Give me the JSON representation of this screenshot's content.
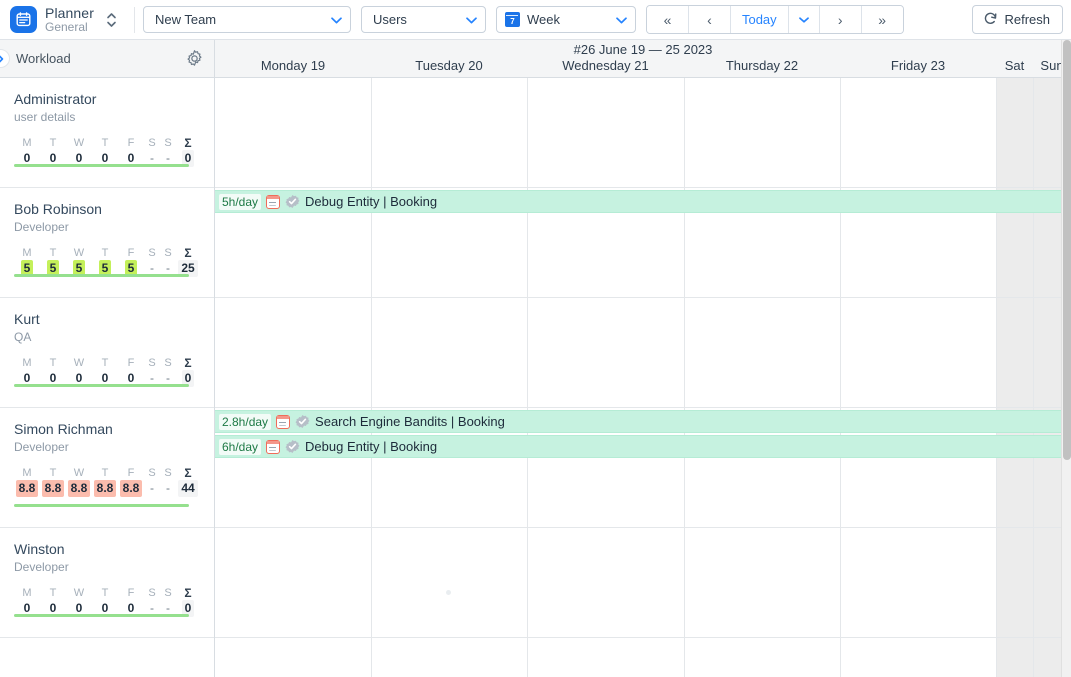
{
  "toolbar": {
    "brand_title": "Planner",
    "brand_subtitle": "General",
    "brand_logo_icon": "calendar-logo-icon",
    "brand_switch_icon": "chevron-up-down-icon",
    "team_select": {
      "value": "New Team",
      "icon": "chevron-down-icon"
    },
    "users_select": {
      "value": "Users",
      "icon": "chevron-down-icon"
    },
    "week_select": {
      "value": "Week",
      "icon": "calendar-7-icon",
      "caret": "chevron-down-icon"
    },
    "nav": {
      "first_label": "«",
      "prev_label": "‹",
      "today_label": "Today",
      "today_caret": "⌄",
      "next_label": "›",
      "last_label": "»"
    },
    "refresh_label": "Refresh",
    "refresh_icon": "refresh-icon"
  },
  "sidebar": {
    "header_title": "Workload",
    "collapse_icon": "chevron-right-icon",
    "settings_icon": "gear-icon",
    "day_headers": [
      "M",
      "T",
      "W",
      "T",
      "F",
      "S",
      "S"
    ],
    "sum_header": "Σ",
    "users": [
      {
        "name": "Administrator",
        "role": "user details",
        "values": [
          "0",
          "0",
          "0",
          "0",
          "0",
          "-",
          "-"
        ],
        "states": [
          "none",
          "none",
          "none",
          "none",
          "none",
          "none",
          "none"
        ],
        "sum": "0"
      },
      {
        "name": "Bob Robinson",
        "role": "Developer",
        "values": [
          "5",
          "5",
          "5",
          "5",
          "5",
          "-",
          "-"
        ],
        "states": [
          "ok",
          "ok",
          "ok",
          "ok",
          "ok",
          "none",
          "none"
        ],
        "sum": "25"
      },
      {
        "name": "Kurt",
        "role": "QA",
        "values": [
          "0",
          "0",
          "0",
          "0",
          "0",
          "-",
          "-"
        ],
        "states": [
          "none",
          "none",
          "none",
          "none",
          "none",
          "none",
          "none"
        ],
        "sum": "0"
      },
      {
        "name": "Simon Richman",
        "role": "Developer",
        "values": [
          "8.8",
          "8.8",
          "8.8",
          "8.8",
          "8.8",
          "-",
          "-"
        ],
        "states": [
          "over",
          "over",
          "over",
          "over",
          "over",
          "none",
          "none"
        ],
        "sum": "44"
      },
      {
        "name": "Winston",
        "role": "Developer",
        "values": [
          "0",
          "0",
          "0",
          "0",
          "0",
          "-",
          "-"
        ],
        "states": [
          "none",
          "none",
          "none",
          "none",
          "none",
          "none",
          "none"
        ],
        "sum": "0"
      }
    ]
  },
  "timeline": {
    "range_label": "#26 June 19 — 25 2023",
    "days": [
      "Monday 19",
      "Tuesday 20",
      "Wednesday 21",
      "Thursday 22",
      "Friday 23",
      "Sat",
      "Sun"
    ],
    "tasks": [
      {
        "hours": "5h/day",
        "title": "Debug Entity | Booking",
        "priority_icon": "priority-card-icon",
        "status_icon": "approved-check-icon",
        "row": 1,
        "order": 0
      },
      {
        "hours": "2.8h/day",
        "title": "Search Engine Bandits | Booking",
        "priority_icon": "priority-card-icon",
        "status_icon": "approved-check-icon",
        "row": 3,
        "order": 0
      },
      {
        "hours": "6h/day",
        "title": "Debug Entity | Booking",
        "priority_icon": "priority-card-icon",
        "status_icon": "approved-check-icon",
        "row": 3,
        "order": 1
      }
    ]
  },
  "colors": {
    "accent": "#1a73e8",
    "link": "#2684ff",
    "task_bar": "#c6f2e0",
    "ok_badge": "#c4f05a",
    "over_badge": "#fbbcad",
    "capacity_bar": "#95e08e"
  }
}
